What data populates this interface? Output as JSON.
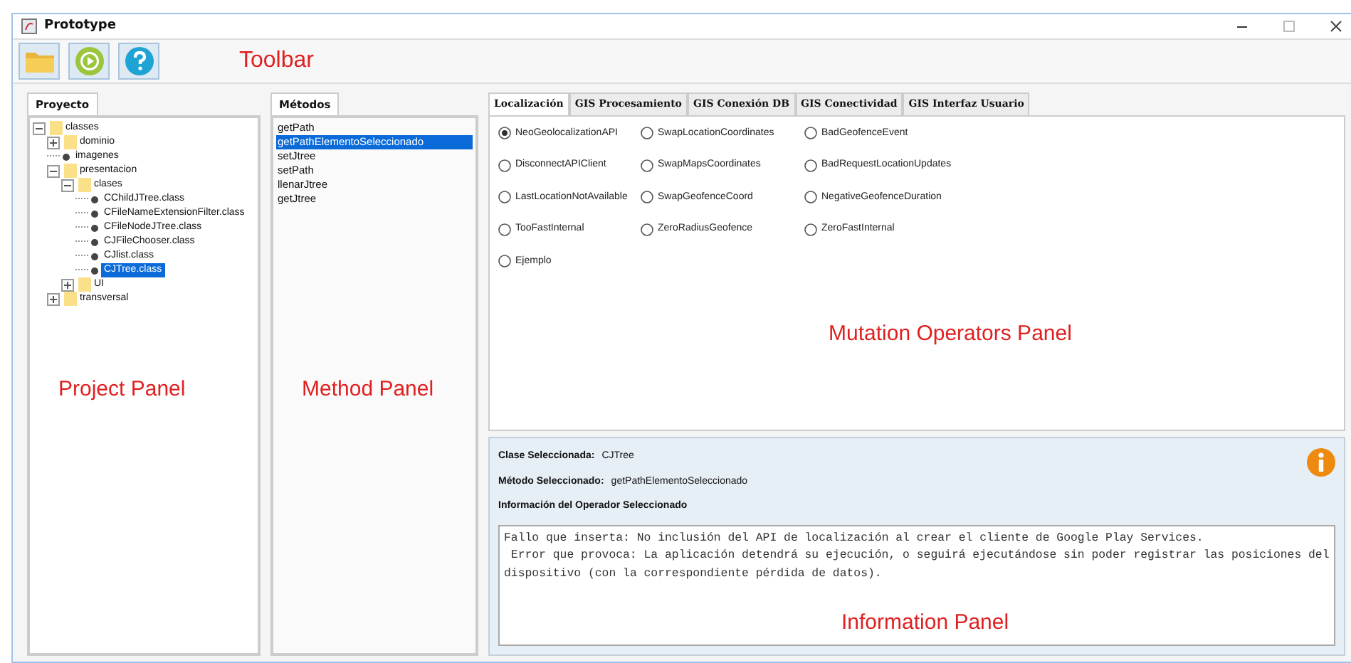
{
  "window": {
    "title": "Prototype"
  },
  "toolbar": {
    "buttons": [
      {
        "kind": "open"
      },
      {
        "kind": "run"
      },
      {
        "kind": "help"
      }
    ],
    "annotation": "Toolbar"
  },
  "project_panel": {
    "tab": "Proyecto",
    "annotation": "Project Panel",
    "tree": [
      {
        "label": "classes",
        "kind": "folder",
        "expanded": true,
        "selected": false,
        "children": [
          {
            "label": "dominio",
            "kind": "folder",
            "expanded": false,
            "selected": false
          },
          {
            "label": "imagenes",
            "kind": "file",
            "selected": false
          },
          {
            "label": "presentacion",
            "kind": "folder",
            "expanded": true,
            "selected": false,
            "children": [
              {
                "label": "clases",
                "kind": "folder",
                "expanded": true,
                "selected": false,
                "children": [
                  {
                    "label": "CChildJTree.class",
                    "kind": "file",
                    "selected": false
                  },
                  {
                    "label": "CFileNameExtensionFilter.class",
                    "kind": "file",
                    "selected": false
                  },
                  {
                    "label": "CFileNodeJTree.class",
                    "kind": "file",
                    "selected": false
                  },
                  {
                    "label": "CJFileChooser.class",
                    "kind": "file",
                    "selected": false
                  },
                  {
                    "label": "CJlist.class",
                    "kind": "file",
                    "selected": false
                  },
                  {
                    "label": "CJTree.class",
                    "kind": "file",
                    "selected": true
                  }
                ]
              },
              {
                "label": "UI",
                "kind": "folder",
                "expanded": false,
                "selected": false
              }
            ]
          },
          {
            "label": "transversal",
            "kind": "folder",
            "expanded": false,
            "selected": false
          }
        ]
      }
    ]
  },
  "method_panel": {
    "tab": "Métodos",
    "annotation": "Method Panel",
    "items": [
      {
        "label": "getPath",
        "selected": false
      },
      {
        "label": "getPathElementoSeleccionado",
        "selected": true
      },
      {
        "label": "setJtree",
        "selected": false
      },
      {
        "label": "setPath",
        "selected": false
      },
      {
        "label": "llenarJtree",
        "selected": false
      },
      {
        "label": "getJtree",
        "selected": false
      }
    ]
  },
  "operators_panel": {
    "annotation": "Mutation Operators Panel",
    "tabs": [
      {
        "label": "Localización",
        "selected": true
      },
      {
        "label": "GIS Procesamiento",
        "selected": false
      },
      {
        "label": "GIS Conexión DB",
        "selected": false
      },
      {
        "label": "GIS Conectividad",
        "selected": false
      },
      {
        "label": "GIS Interfaz Usuario",
        "selected": false
      }
    ],
    "operators": [
      {
        "label": "NeoGeolocalizationAPI",
        "selected": true
      },
      {
        "label": "SwapLocationCoordinates",
        "selected": false
      },
      {
        "label": "BadGeofenceEvent",
        "selected": false
      },
      {
        "label": "DisconnectAPIClient",
        "selected": false
      },
      {
        "label": "SwapMapsCoordinates",
        "selected": false
      },
      {
        "label": "BadRequestLocationUpdates",
        "selected": false
      },
      {
        "label": "LastLocationNotAvailable",
        "selected": false
      },
      {
        "label": "SwapGeofenceCoord",
        "selected": false
      },
      {
        "label": "NegativeGeofenceDuration",
        "selected": false
      },
      {
        "label": "TooFastInternal",
        "selected": false
      },
      {
        "label": "ZeroRadiusGeofence",
        "selected": false
      },
      {
        "label": "ZeroFastInternal",
        "selected": false
      },
      {
        "label": "Ejemplo",
        "selected": false
      }
    ]
  },
  "info_panel": {
    "annotation": "Information Panel",
    "fields": [
      {
        "label": "Clase Seleccionada:",
        "value": "CJTree"
      },
      {
        "label": "Método Seleccionado:",
        "value": "getPathElementoSeleccionado"
      }
    ],
    "heading": "Información del Operador Seleccionado",
    "text_lines": [
      "Fallo que inserta: No inclusión del API de localización al crear el cliente de Google Play Services.",
      "Error que provoca: La aplicación detendrá su ejecución, o seguirá ejecutándose sin poder registrar las posiciones del",
      "dispositivo (con la correspondiente pérdida de datos)."
    ]
  }
}
